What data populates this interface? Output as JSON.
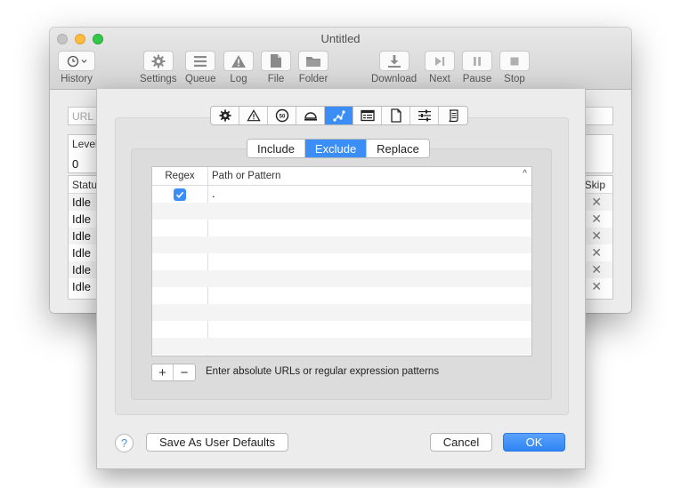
{
  "window": {
    "title": "Untitled",
    "toolbar": [
      {
        "label": "History",
        "icon": "history-clock-icon"
      },
      {
        "label": "Settings",
        "icon": "gear-icon"
      },
      {
        "label": "Queue",
        "icon": "list-icon"
      },
      {
        "label": "Log",
        "icon": "warning-icon"
      },
      {
        "label": "File",
        "icon": "file-icon"
      },
      {
        "label": "Folder",
        "icon": "folder-icon"
      },
      {
        "label": "Download",
        "icon": "download-icon"
      },
      {
        "label": "Next",
        "icon": "next-icon"
      },
      {
        "label": "Pause",
        "icon": "pause-icon"
      },
      {
        "label": "Stop",
        "icon": "stop-icon"
      }
    ],
    "url_placeholder": "URL",
    "level": {
      "label": "Level",
      "value": "0"
    },
    "queue": {
      "status_header": "Status",
      "skip_header": "Skip",
      "rows": [
        "Idle",
        "Idle",
        "Idle",
        "Idle",
        "Idle",
        "Idle"
      ]
    }
  },
  "sheet": {
    "tab_icons": [
      "gear-icon",
      "warning-icon",
      "speed-limit-icon",
      "bell-icon",
      "filter-path-icon",
      "browser-icon",
      "document-icon",
      "sliders-icon",
      "script-icon"
    ],
    "active_tab_index": 4,
    "segments": [
      "Include",
      "Exclude",
      "Replace"
    ],
    "active_segment": "Exclude",
    "table": {
      "col_regex": "Regex",
      "col_path": "Path or Pattern",
      "sort_indicator": "^",
      "rows": [
        {
          "regex": true,
          "pattern": "."
        }
      ]
    },
    "add_label": "+",
    "remove_label": "−",
    "hint": "Enter absolute URLs or regular expression patterns",
    "help_label": "?",
    "save_defaults_label": "Save As User Defaults",
    "cancel_label": "Cancel",
    "ok_label": "OK"
  },
  "colors": {
    "accent": "#3c8ef7"
  }
}
